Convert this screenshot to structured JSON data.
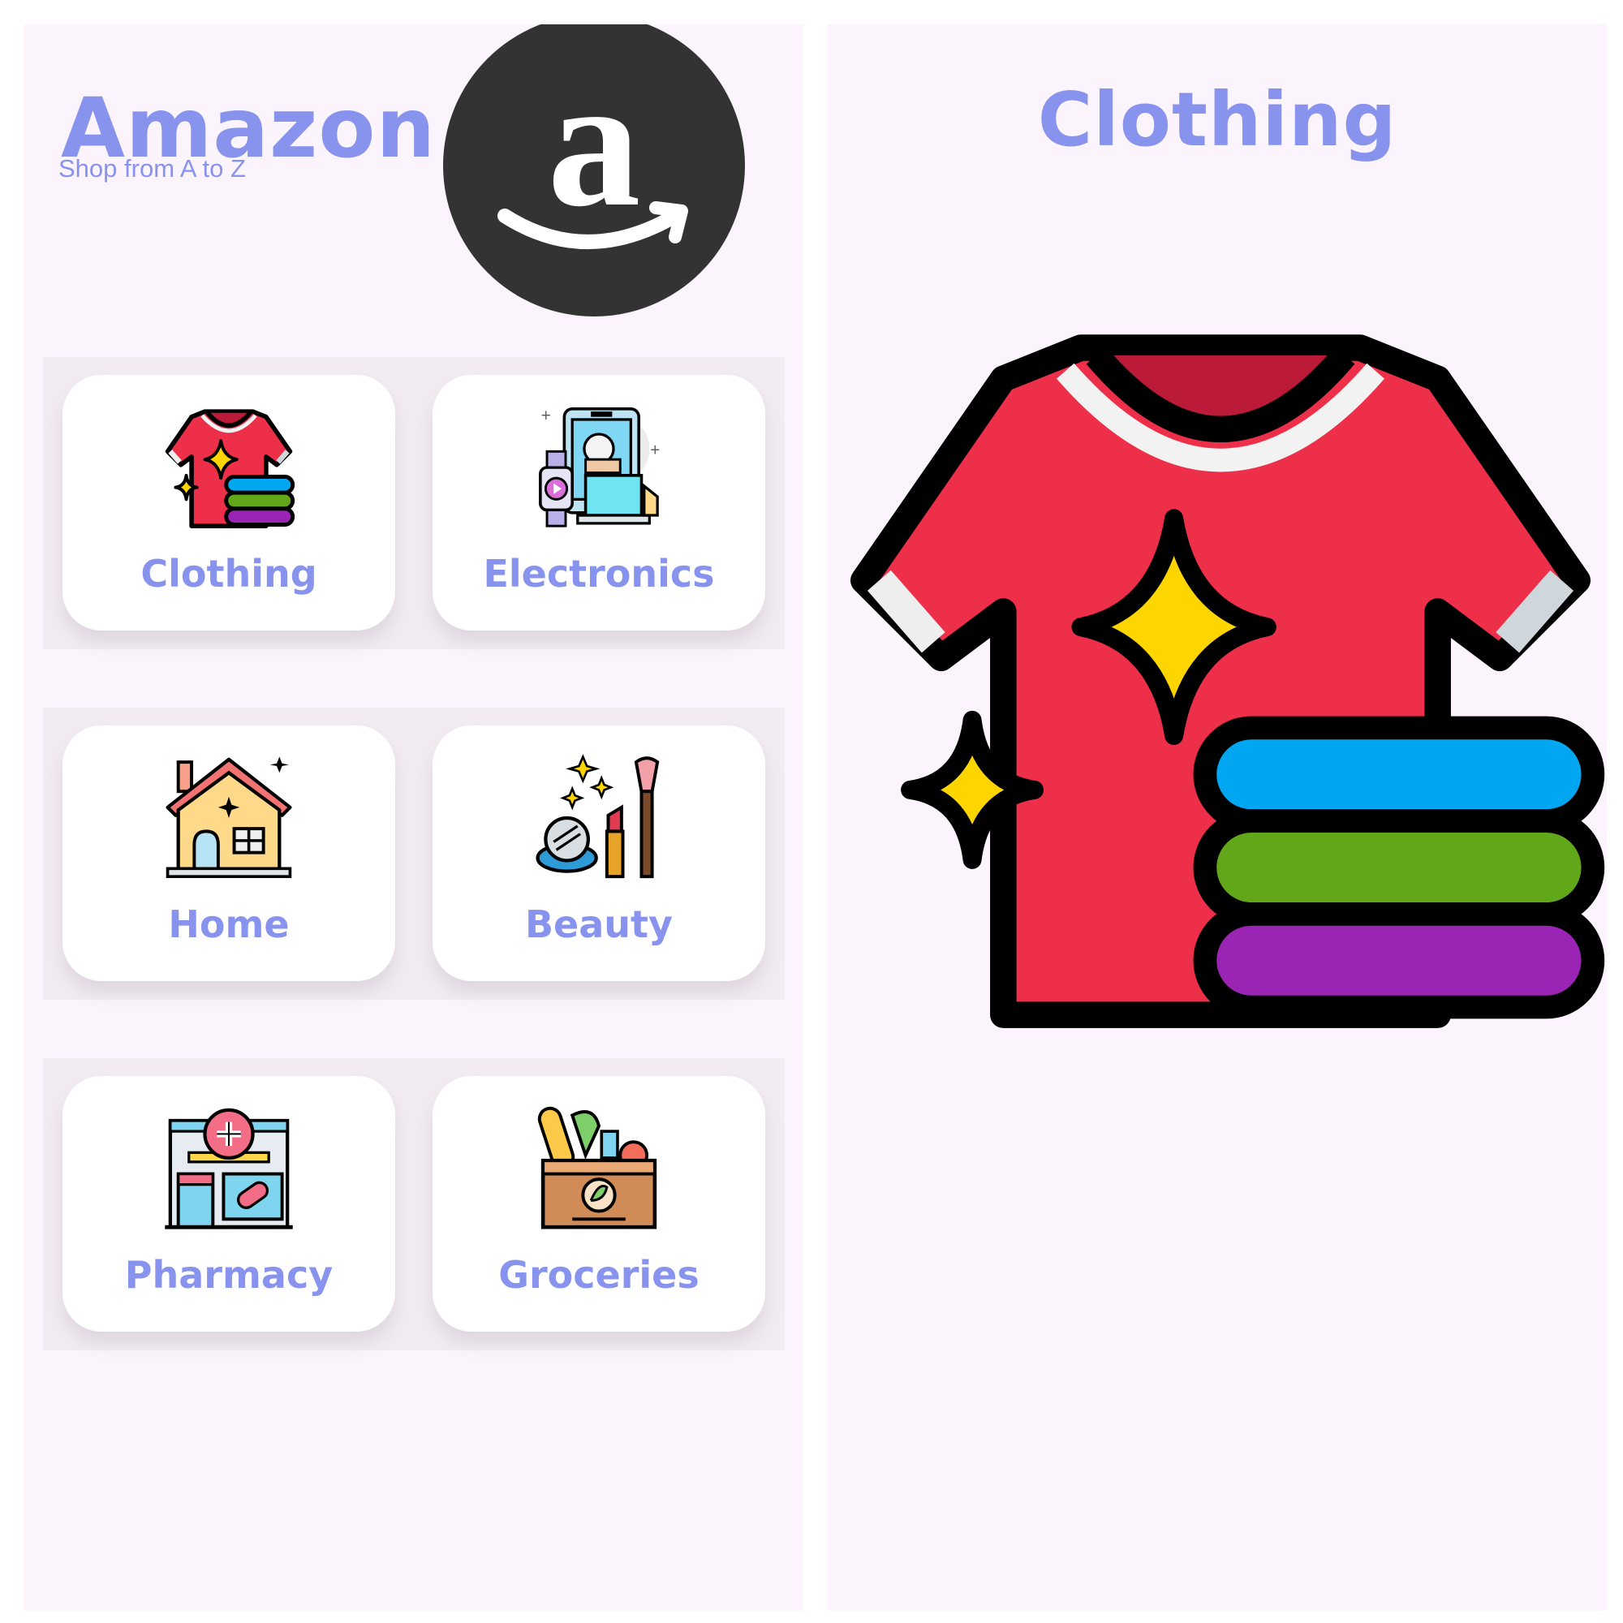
{
  "app": {
    "title": "Amazon",
    "subtitle": "Shop from A to Z",
    "logo_icon": "amazon-smile-logo",
    "accent_color": "#8893ee",
    "background_color": "#fcf4fc"
  },
  "categories": [
    {
      "label": "Clothing",
      "icon": "tshirt-icon"
    },
    {
      "label": "Electronics",
      "icon": "devices-icon"
    },
    {
      "label": "Home",
      "icon": "house-icon"
    },
    {
      "label": "Beauty",
      "icon": "makeup-icon"
    },
    {
      "label": "Pharmacy",
      "icon": "pharmacy-icon"
    },
    {
      "label": "Groceries",
      "icon": "grocery-bag-icon"
    }
  ],
  "detail": {
    "title": "Clothing",
    "image_icon": "tshirt-icon"
  }
}
